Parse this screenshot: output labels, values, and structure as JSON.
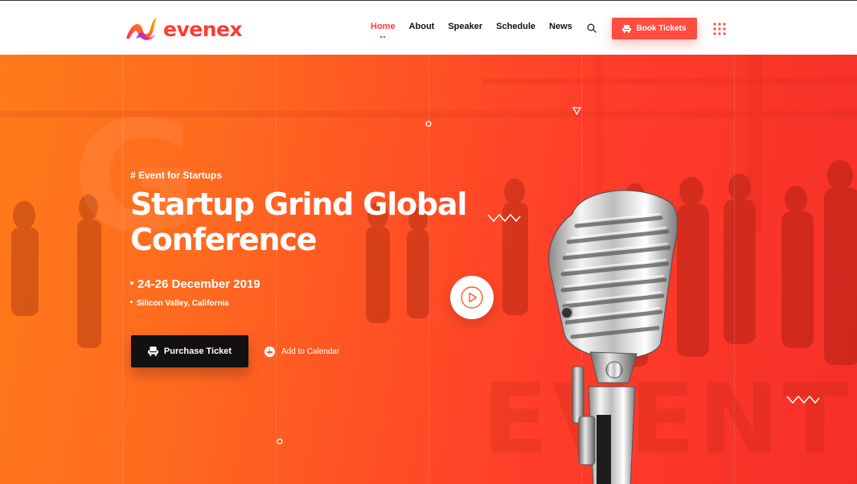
{
  "brand": {
    "logo_text": "evenex",
    "accent": "#ff4d40"
  },
  "nav": {
    "items": [
      {
        "label": "Home",
        "active": true
      },
      {
        "label": "About",
        "active": false
      },
      {
        "label": "Speaker",
        "active": false
      },
      {
        "label": "Schedule",
        "active": false
      },
      {
        "label": "News",
        "active": false
      }
    ],
    "search_icon": "search-icon",
    "book_label": "Book Tickets",
    "menu_icon": "grid-dots-icon"
  },
  "hero": {
    "tagline": "# Event for Startups",
    "title_line1": "Startup Grind Global",
    "title_line2": "Conference",
    "date": "24-26 December 2019",
    "location": "Silicon Valley, California",
    "purchase_label": "Purchase Ticket",
    "calendar_label": "Add to Calendar",
    "play_icon": "play-icon",
    "background_letters": "G",
    "background_word": "EVENT",
    "gradient": [
      "#ff7a1a",
      "#f52f28"
    ]
  }
}
